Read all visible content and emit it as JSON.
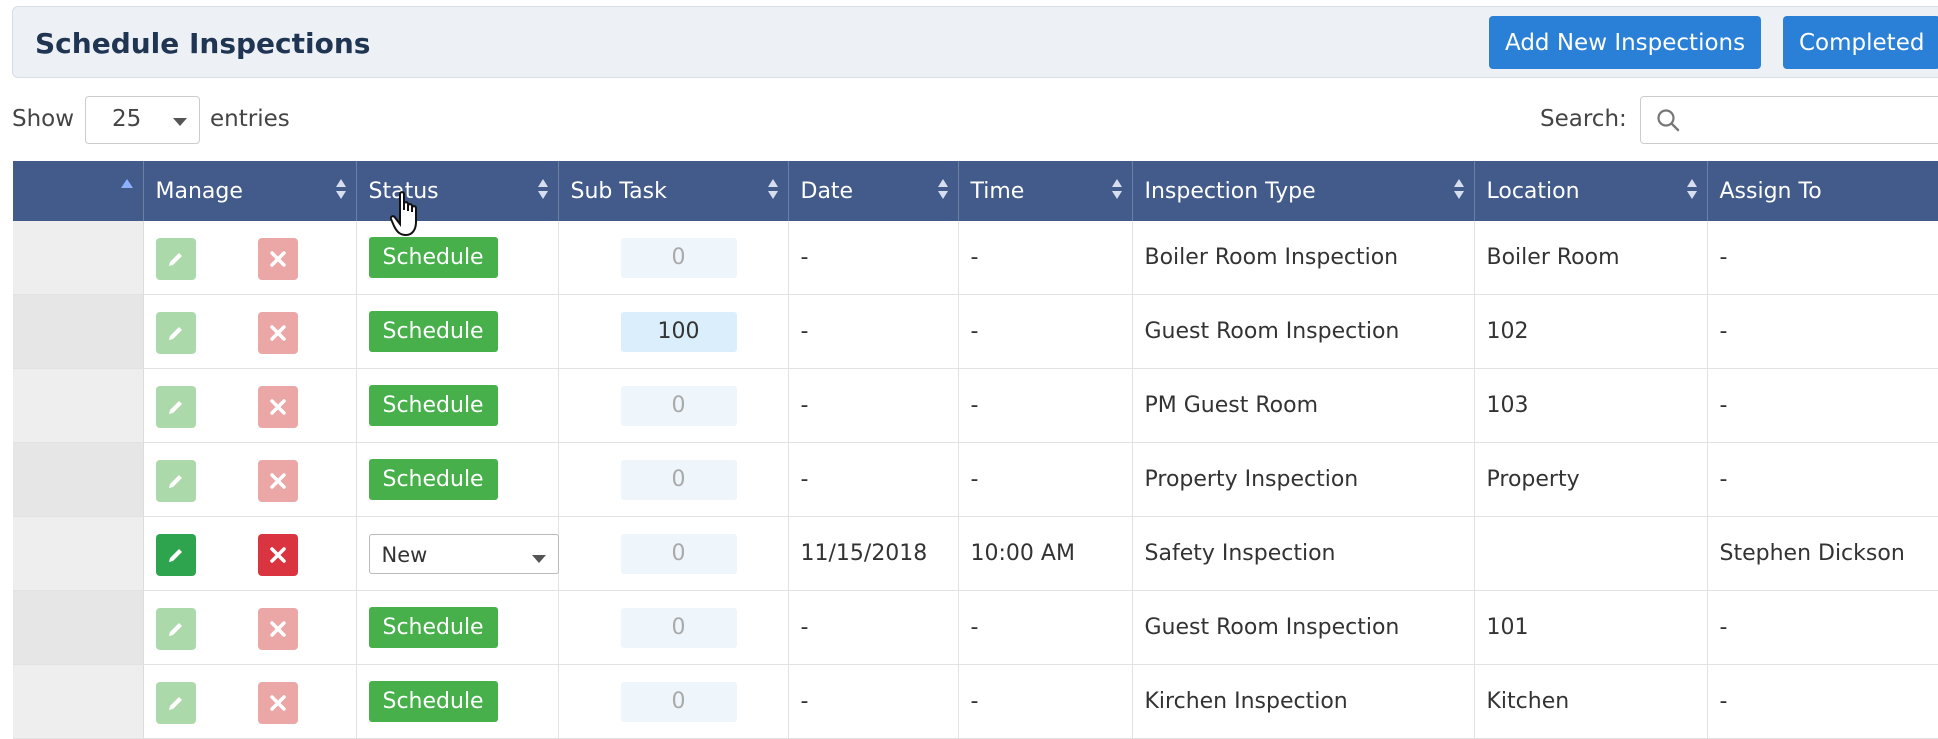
{
  "page": {
    "title": "Schedule Inspections",
    "add_button": "Add New Inspections",
    "completed_button": "Completed"
  },
  "controls": {
    "show_label": "Show",
    "entries_value": "25",
    "entries_label": "entries",
    "search_label": "Search:",
    "search_placeholder": ""
  },
  "table": {
    "headers": [
      "",
      "Manage",
      "Status",
      "Sub Task",
      "Date",
      "Time",
      "Inspection Type",
      "Location",
      "Assign To"
    ],
    "rows": [
      {
        "status": "Schedule",
        "subtask": "0",
        "date": "-",
        "time": "-",
        "type": "Boiler Room Inspection",
        "location": "Boiler Room",
        "assign": "-"
      },
      {
        "status": "Schedule",
        "subtask": "100",
        "date": "-",
        "time": "-",
        "type": "Guest Room Inspection",
        "location": "102",
        "assign": "-"
      },
      {
        "status": "Schedule",
        "subtask": "0",
        "date": "-",
        "time": "-",
        "type": "PM Guest Room",
        "location": "103",
        "assign": "-"
      },
      {
        "status": "Schedule",
        "subtask": "0",
        "date": "-",
        "time": "-",
        "type": "Property Inspection",
        "location": "Property",
        "assign": "-"
      },
      {
        "status": "New",
        "subtask": "0",
        "date": "11/15/2018",
        "time": "10:00 AM",
        "type": "Safety Inspection",
        "location": "",
        "assign": "Stephen Dickson"
      },
      {
        "status": "Schedule",
        "subtask": "0",
        "date": "-",
        "time": "-",
        "type": "Guest Room Inspection",
        "location": "101",
        "assign": "-"
      },
      {
        "status": "Schedule",
        "subtask": "0",
        "date": "-",
        "time": "-",
        "type": "Kirchen Inspection",
        "location": "Kitchen",
        "assign": "-"
      }
    ]
  },
  "colors": {
    "header_bg": "#425b8a",
    "primary_button": "#2a7fd6",
    "schedule_green": "#47b04b",
    "edit_green": "#2ea44f",
    "delete_red": "#d9343f"
  },
  "icons": {
    "edit": "pencil-icon",
    "delete": "x-icon",
    "search": "search-icon",
    "cursor": "hand-pointer-icon"
  }
}
